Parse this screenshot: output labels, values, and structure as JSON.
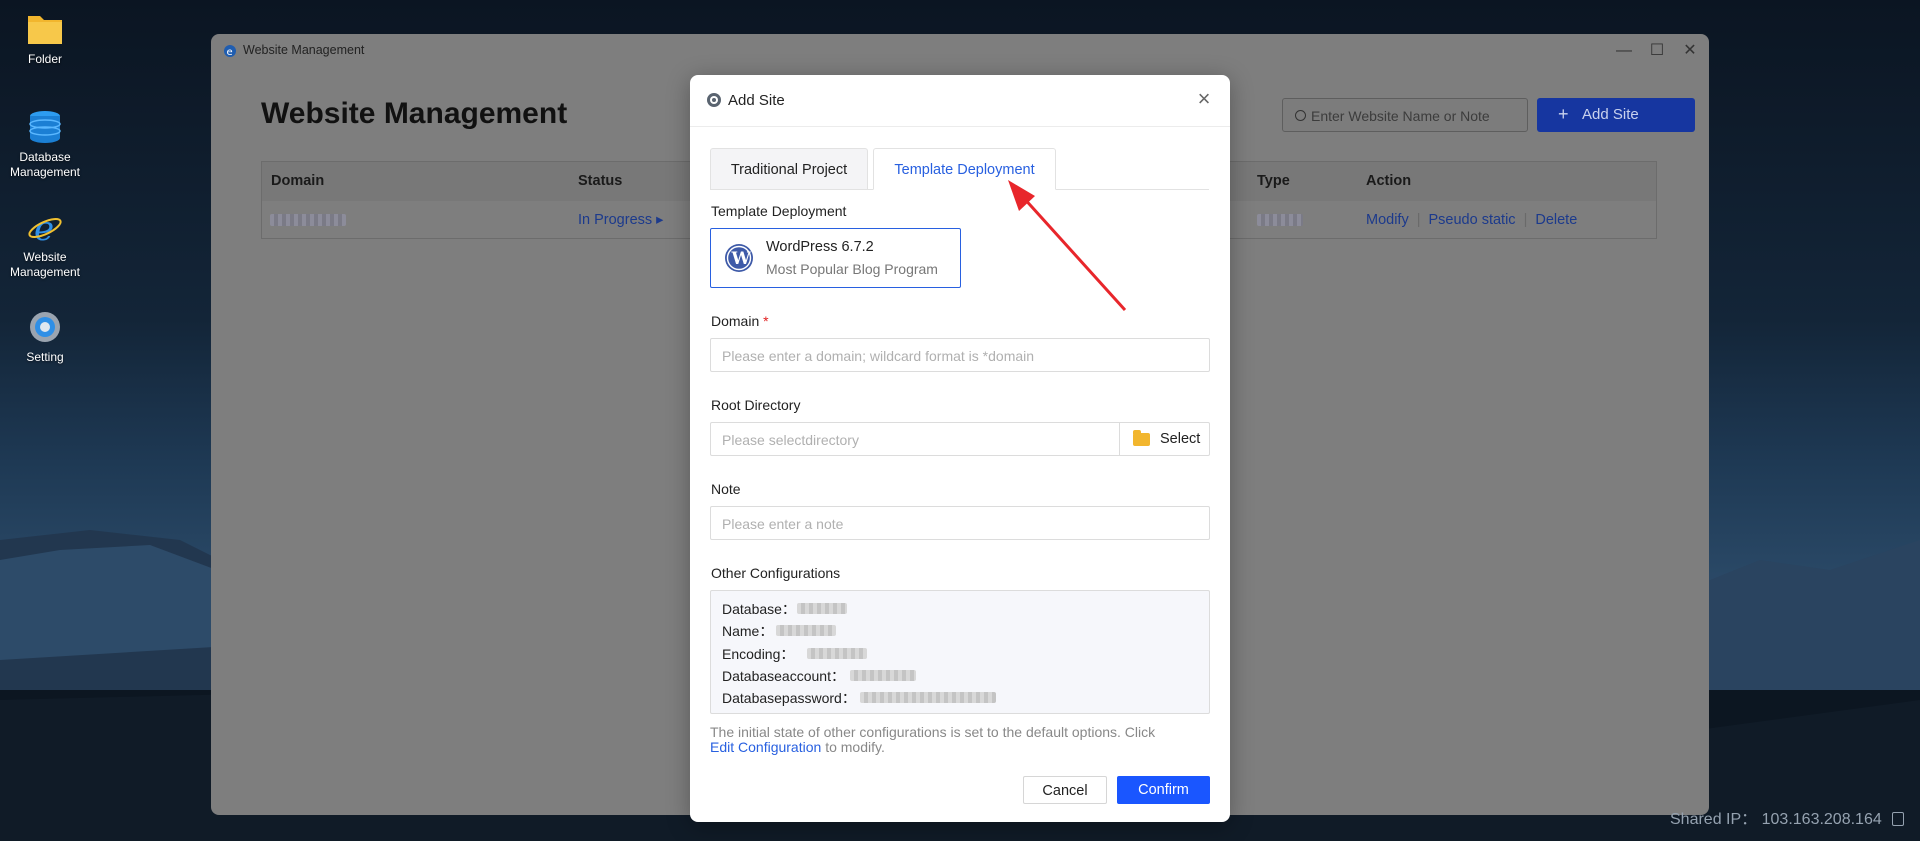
{
  "desktop": {
    "icons": [
      {
        "label": "Folder"
      },
      {
        "label": "Database Management"
      },
      {
        "label": "Website Management"
      },
      {
        "label": "Setting"
      }
    ],
    "shared_ip_label": "Shared IP：",
    "shared_ip_value": "103.163.208.164"
  },
  "window": {
    "title": "Website Management",
    "heading": "Website Management",
    "search_placeholder": "Enter Website Name or Note",
    "add_site_label": "Add Site",
    "controls": {
      "minimize": "—",
      "maximize": "☐",
      "close": "✕"
    },
    "table": {
      "headers": {
        "domain": "Domain",
        "status": "Status",
        "type": "Type",
        "action": "Action"
      },
      "row": {
        "status": "In Progress",
        "actions": {
          "modify": "Modify",
          "pseudo_static": "Pseudo static",
          "delete": "Delete"
        }
      }
    }
  },
  "modal": {
    "title": "Add Site",
    "tabs": {
      "traditional": "Traditional Project",
      "template": "Template Deployment"
    },
    "template_label": "Template Deployment",
    "template_card": {
      "name": "WordPress 6.7.2",
      "desc": "Most Popular Blog Program"
    },
    "domain_label": "Domain",
    "domain_required": "*",
    "domain_placeholder": "Please enter a domain; wildcard format is *domain",
    "root_label": "Root Directory",
    "root_placeholder": "Please selectdirectory",
    "select_label": "Select",
    "note_label": "Note",
    "note_placeholder": "Please enter a note",
    "other_label": "Other Configurations",
    "config": {
      "database": "Database：",
      "name": "Name：",
      "encoding": "Encoding：",
      "db_account": "Databaseaccount：",
      "db_password": "Databasepassword："
    },
    "hint_prefix": "The initial state of other configurations is set to the default options. Click",
    "hint_link": "Edit Configuration",
    "hint_suffix": "to modify.",
    "cancel_label": "Cancel",
    "confirm_label": "Confirm"
  },
  "colors": {
    "accent": "#2860e0",
    "confirm": "#1a56ff",
    "annotation_arrow": "#e8262b"
  }
}
